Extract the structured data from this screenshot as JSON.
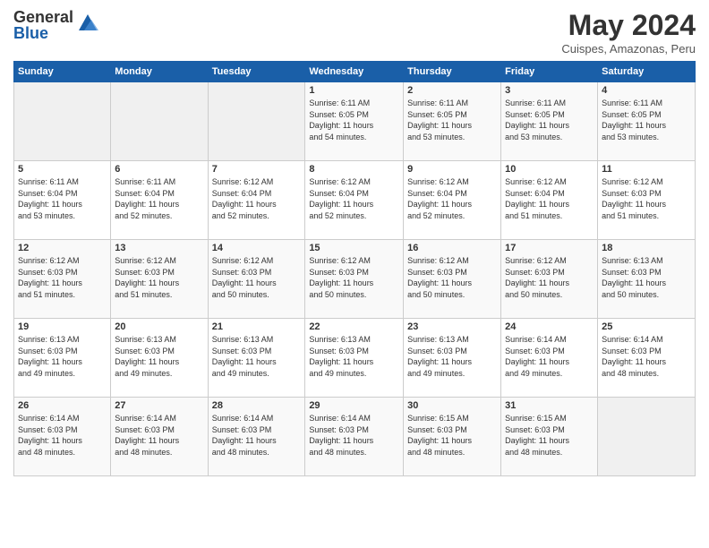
{
  "logo": {
    "general": "General",
    "blue": "Blue"
  },
  "title": "May 2024",
  "subtitle": "Cuispes, Amazonas, Peru",
  "weekdays": [
    "Sunday",
    "Monday",
    "Tuesday",
    "Wednesday",
    "Thursday",
    "Friday",
    "Saturday"
  ],
  "weeks": [
    [
      {
        "day": "",
        "info": ""
      },
      {
        "day": "",
        "info": ""
      },
      {
        "day": "",
        "info": ""
      },
      {
        "day": "1",
        "info": "Sunrise: 6:11 AM\nSunset: 6:05 PM\nDaylight: 11 hours\nand 54 minutes."
      },
      {
        "day": "2",
        "info": "Sunrise: 6:11 AM\nSunset: 6:05 PM\nDaylight: 11 hours\nand 53 minutes."
      },
      {
        "day": "3",
        "info": "Sunrise: 6:11 AM\nSunset: 6:05 PM\nDaylight: 11 hours\nand 53 minutes."
      },
      {
        "day": "4",
        "info": "Sunrise: 6:11 AM\nSunset: 6:05 PM\nDaylight: 11 hours\nand 53 minutes."
      }
    ],
    [
      {
        "day": "5",
        "info": "Sunrise: 6:11 AM\nSunset: 6:04 PM\nDaylight: 11 hours\nand 53 minutes."
      },
      {
        "day": "6",
        "info": "Sunrise: 6:11 AM\nSunset: 6:04 PM\nDaylight: 11 hours\nand 52 minutes."
      },
      {
        "day": "7",
        "info": "Sunrise: 6:12 AM\nSunset: 6:04 PM\nDaylight: 11 hours\nand 52 minutes."
      },
      {
        "day": "8",
        "info": "Sunrise: 6:12 AM\nSunset: 6:04 PM\nDaylight: 11 hours\nand 52 minutes."
      },
      {
        "day": "9",
        "info": "Sunrise: 6:12 AM\nSunset: 6:04 PM\nDaylight: 11 hours\nand 52 minutes."
      },
      {
        "day": "10",
        "info": "Sunrise: 6:12 AM\nSunset: 6:04 PM\nDaylight: 11 hours\nand 51 minutes."
      },
      {
        "day": "11",
        "info": "Sunrise: 6:12 AM\nSunset: 6:03 PM\nDaylight: 11 hours\nand 51 minutes."
      }
    ],
    [
      {
        "day": "12",
        "info": "Sunrise: 6:12 AM\nSunset: 6:03 PM\nDaylight: 11 hours\nand 51 minutes."
      },
      {
        "day": "13",
        "info": "Sunrise: 6:12 AM\nSunset: 6:03 PM\nDaylight: 11 hours\nand 51 minutes."
      },
      {
        "day": "14",
        "info": "Sunrise: 6:12 AM\nSunset: 6:03 PM\nDaylight: 11 hours\nand 50 minutes."
      },
      {
        "day": "15",
        "info": "Sunrise: 6:12 AM\nSunset: 6:03 PM\nDaylight: 11 hours\nand 50 minutes."
      },
      {
        "day": "16",
        "info": "Sunrise: 6:12 AM\nSunset: 6:03 PM\nDaylight: 11 hours\nand 50 minutes."
      },
      {
        "day": "17",
        "info": "Sunrise: 6:12 AM\nSunset: 6:03 PM\nDaylight: 11 hours\nand 50 minutes."
      },
      {
        "day": "18",
        "info": "Sunrise: 6:13 AM\nSunset: 6:03 PM\nDaylight: 11 hours\nand 50 minutes."
      }
    ],
    [
      {
        "day": "19",
        "info": "Sunrise: 6:13 AM\nSunset: 6:03 PM\nDaylight: 11 hours\nand 49 minutes."
      },
      {
        "day": "20",
        "info": "Sunrise: 6:13 AM\nSunset: 6:03 PM\nDaylight: 11 hours\nand 49 minutes."
      },
      {
        "day": "21",
        "info": "Sunrise: 6:13 AM\nSunset: 6:03 PM\nDaylight: 11 hours\nand 49 minutes."
      },
      {
        "day": "22",
        "info": "Sunrise: 6:13 AM\nSunset: 6:03 PM\nDaylight: 11 hours\nand 49 minutes."
      },
      {
        "day": "23",
        "info": "Sunrise: 6:13 AM\nSunset: 6:03 PM\nDaylight: 11 hours\nand 49 minutes."
      },
      {
        "day": "24",
        "info": "Sunrise: 6:14 AM\nSunset: 6:03 PM\nDaylight: 11 hours\nand 49 minutes."
      },
      {
        "day": "25",
        "info": "Sunrise: 6:14 AM\nSunset: 6:03 PM\nDaylight: 11 hours\nand 48 minutes."
      }
    ],
    [
      {
        "day": "26",
        "info": "Sunrise: 6:14 AM\nSunset: 6:03 PM\nDaylight: 11 hours\nand 48 minutes."
      },
      {
        "day": "27",
        "info": "Sunrise: 6:14 AM\nSunset: 6:03 PM\nDaylight: 11 hours\nand 48 minutes."
      },
      {
        "day": "28",
        "info": "Sunrise: 6:14 AM\nSunset: 6:03 PM\nDaylight: 11 hours\nand 48 minutes."
      },
      {
        "day": "29",
        "info": "Sunrise: 6:14 AM\nSunset: 6:03 PM\nDaylight: 11 hours\nand 48 minutes."
      },
      {
        "day": "30",
        "info": "Sunrise: 6:15 AM\nSunset: 6:03 PM\nDaylight: 11 hours\nand 48 minutes."
      },
      {
        "day": "31",
        "info": "Sunrise: 6:15 AM\nSunset: 6:03 PM\nDaylight: 11 hours\nand 48 minutes."
      },
      {
        "day": "",
        "info": ""
      }
    ]
  ]
}
